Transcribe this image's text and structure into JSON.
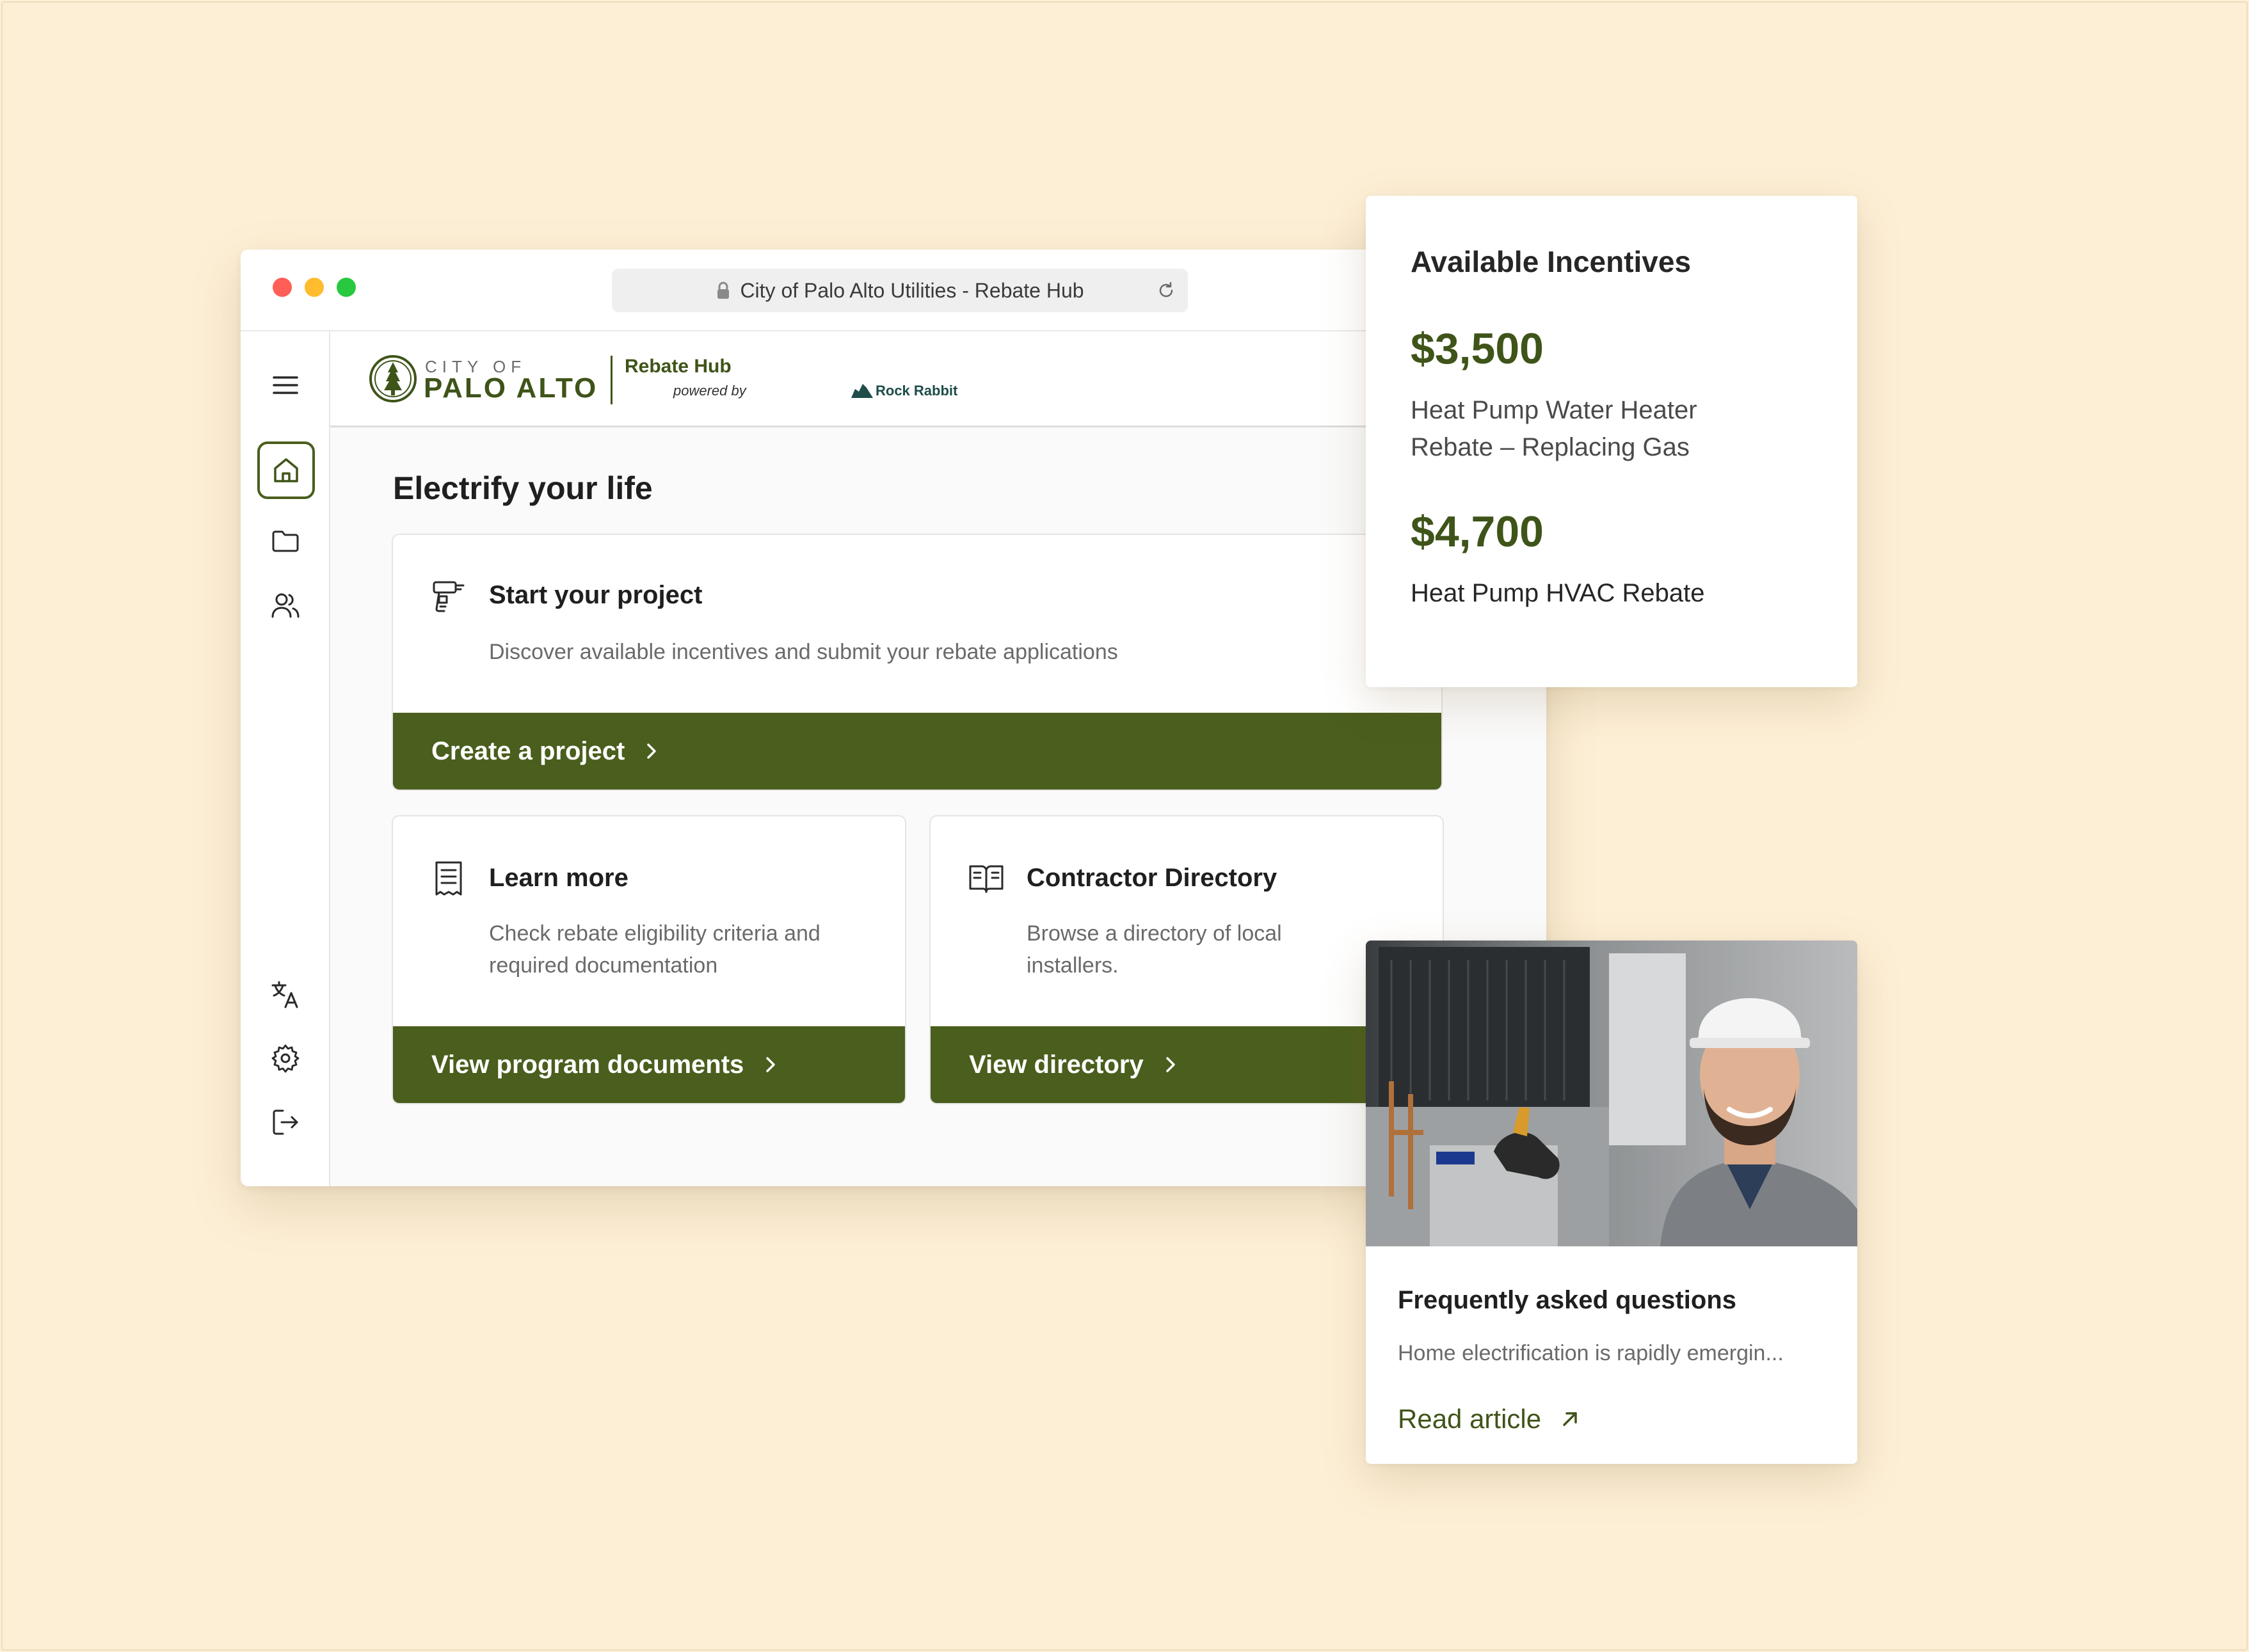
{
  "browser": {
    "address": "City of Palo Alto Utilities - Rebate Hub"
  },
  "header": {
    "city_of": "CITY OF",
    "palo_alto": "PALO ALTO",
    "hub_title": "Rebate Hub",
    "powered_by": "powered by",
    "partner": "Rock Rabbit"
  },
  "sidebar": {
    "items": [
      {
        "icon": "menu-icon"
      },
      {
        "icon": "home-icon",
        "active": true
      },
      {
        "icon": "folder-icon"
      },
      {
        "icon": "users-icon"
      },
      {
        "icon": "translate-icon"
      },
      {
        "icon": "settings-icon"
      },
      {
        "icon": "logout-icon"
      }
    ]
  },
  "main": {
    "title": "Electrify your life",
    "start_card": {
      "icon": "drill-icon",
      "title": "Start your project",
      "description": "Discover available incentives and submit your rebate applications",
      "button": "Create a project"
    },
    "learn_card": {
      "icon": "document-icon",
      "title": "Learn more",
      "description_line1": "Check rebate eligibility criteria and",
      "description_line2": "required documentation",
      "button": "View program documents"
    },
    "directory_card": {
      "icon": "book-icon",
      "title": "Contractor Directory",
      "description_line1": "Browse a directory of local",
      "description_line2": "installers.",
      "button": "View directory"
    }
  },
  "incentives": {
    "heading": "Available Incentives",
    "items": [
      {
        "amount": "$3,500",
        "label_line1": "Heat Pump Water Heater",
        "label_line2": "Rebate – Replacing Gas"
      },
      {
        "amount": "$4,700",
        "label_line1": "Heat Pump HVAC Rebate"
      }
    ]
  },
  "faq": {
    "title": "Frequently asked questions",
    "excerpt": "Home electrification is rapidly emergin...",
    "link": "Read article"
  },
  "colors": {
    "background": "#FDEFD6",
    "brand_green": "#4A5E1D",
    "text_dark": "#1f1f1f",
    "text_muted": "#6a6a6a"
  }
}
